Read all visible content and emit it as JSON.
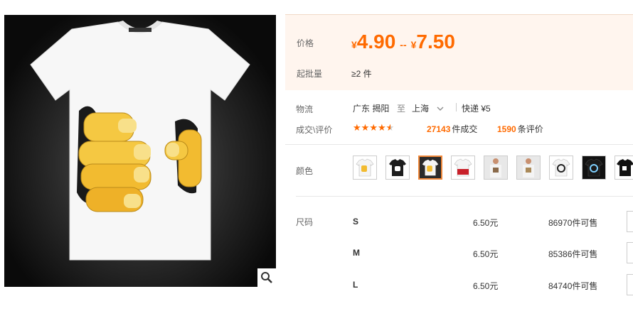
{
  "header": {
    "title_cut": "▔▔▔▔▔▔▔▔▔▔▔▔▔▔▔▔▔▔▔▔▔▔▔▔▔▔▔▔▔▔"
  },
  "price": {
    "label": "价格",
    "currency": "¥",
    "min": "4.90",
    "sep": "--",
    "max": "7.50",
    "moq_label": "起批量",
    "moq_value": "≥2 件"
  },
  "logistics": {
    "label": "物流",
    "from": "广东 揭阳",
    "to_word": "至",
    "dest": "上海",
    "shipping": "快递 ¥5"
  },
  "deals": {
    "label": "成交\\评价",
    "rating": 4.5,
    "count": "27143",
    "count_suffix": "件成交",
    "reviews": "1590",
    "reviews_suffix": "条评价"
  },
  "color": {
    "label": "颜色",
    "selected_index": 2,
    "swatch_count": 9
  },
  "size": {
    "label": "尺码",
    "rows": [
      {
        "size": "S",
        "price": "6.50元",
        "stock": "86970件可售"
      },
      {
        "size": "M",
        "price": "6.50元",
        "stock": "85386件可售"
      },
      {
        "size": "L",
        "price": "6.50元",
        "stock": "84740件可售"
      }
    ]
  },
  "colors": {
    "accent": "#ff6a00",
    "panel_bg": "#fff5ee",
    "selected_border": "#f0883a"
  }
}
